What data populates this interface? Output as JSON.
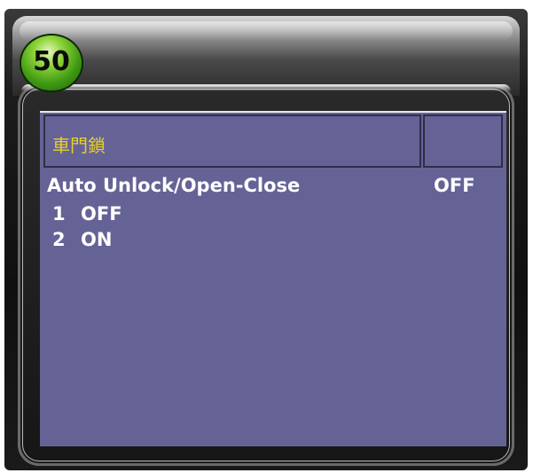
{
  "page_badge": "50",
  "header": {
    "title": "車門鎖"
  },
  "setting": {
    "name": "Auto Unlock/Open-Close",
    "current_value": "OFF"
  },
  "options": [
    {
      "number": "1",
      "label": "OFF"
    },
    {
      "number": "2",
      "label": "ON"
    }
  ],
  "colors": {
    "screen_background": "#656396",
    "title_text": "#e6cf2b",
    "badge_green": "#3f9a12"
  }
}
